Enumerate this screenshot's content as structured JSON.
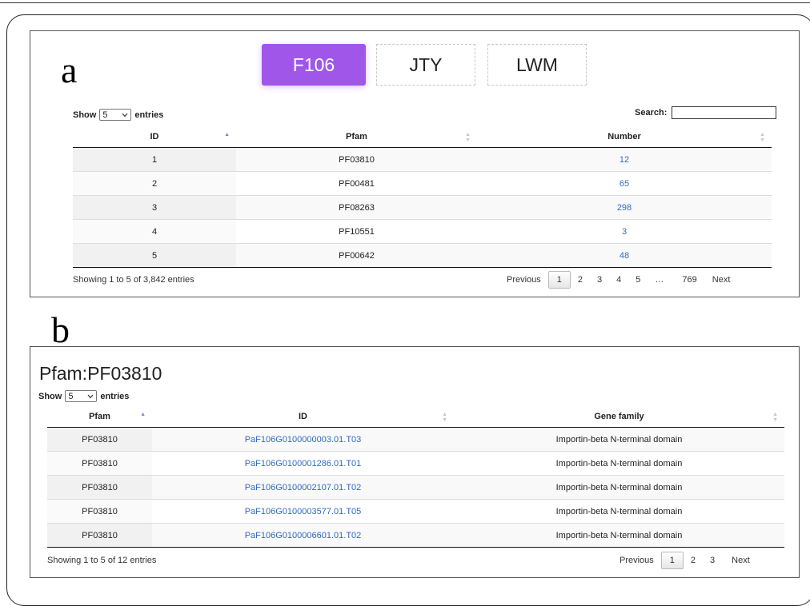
{
  "panel_a": {
    "letter": "a",
    "tabs": [
      {
        "label": "F106",
        "active": true
      },
      {
        "label": "JTY",
        "active": false
      },
      {
        "label": "LWM",
        "active": false
      }
    ],
    "length": {
      "prefix": "Show",
      "value": "5",
      "suffix": "entries"
    },
    "search_label": "Search:",
    "columns": [
      "ID",
      "Pfam",
      "Number"
    ],
    "rows": [
      [
        "1",
        "PF03810",
        "12"
      ],
      [
        "2",
        "PF00481",
        "65"
      ],
      [
        "3",
        "PF08263",
        "298"
      ],
      [
        "4",
        "PF10551",
        "3"
      ],
      [
        "5",
        "PF00642",
        "48"
      ]
    ],
    "info": "Showing 1 to 5 of 3,842 entries",
    "pagination": {
      "previous": "Previous",
      "pages": [
        "1",
        "2",
        "3",
        "4",
        "5",
        "…",
        "769"
      ],
      "next": "Next"
    }
  },
  "panel_b": {
    "letter": "b",
    "title": "Pfam:PF03810",
    "length": {
      "prefix": "Show",
      "value": "5",
      "suffix": "entries"
    },
    "columns": [
      "Pfam",
      "ID",
      "Gene family"
    ],
    "rows": [
      [
        "PF03810",
        "PaF106G0100000003.01.T03",
        "Importin-beta N-terminal domain"
      ],
      [
        "PF03810",
        "PaF106G0100001286.01.T01",
        "Importin-beta N-terminal domain"
      ],
      [
        "PF03810",
        "PaF106G0100002107.01.T02",
        "Importin-beta N-terminal domain"
      ],
      [
        "PF03810",
        "PaF106G0100003577.01.T05",
        "Importin-beta N-terminal domain"
      ],
      [
        "PF03810",
        "PaF106G0100006601.01.T02",
        "Importin-beta N-terminal domain"
      ]
    ],
    "info": "Showing 1 to 5 of 12 entries",
    "pagination": {
      "previous": "Previous",
      "pages": [
        "1",
        "2",
        "3"
      ],
      "next": "Next"
    }
  },
  "colors": {
    "active_tab": "#a156ea",
    "link": "#3169c6",
    "sort_active": "#6f8fd1"
  },
  "icons": {
    "select_arrow": "chevron-down-icon",
    "sort": "sort-both-icon",
    "sort_asc": "sort-asc-icon"
  }
}
